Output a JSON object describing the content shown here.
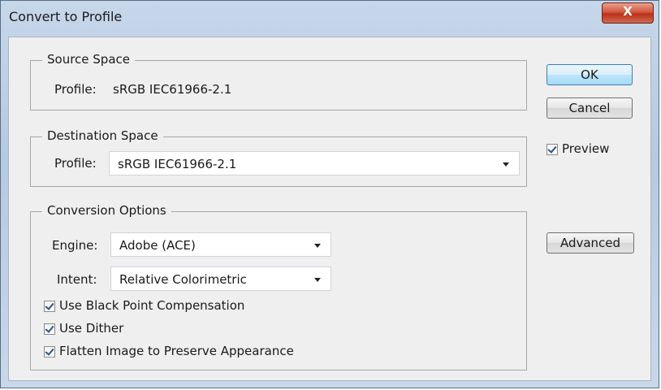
{
  "window": {
    "title": "Convert to Profile",
    "close_label": "X"
  },
  "source_space": {
    "legend": "Source Space",
    "profile_label": "Profile:",
    "profile_value": "sRGB IEC61966-2.1"
  },
  "destination_space": {
    "legend": "Destination Space",
    "profile_label": "Profile:",
    "profile_value": "sRGB IEC61966-2.1"
  },
  "conversion_options": {
    "legend": "Conversion Options",
    "engine_label": "Engine:",
    "engine_value": "Adobe (ACE)",
    "intent_label": "Intent:",
    "intent_value": "Relative Colorimetric",
    "black_point_label": "Use Black Point Compensation",
    "black_point_checked": true,
    "dither_label": "Use Dither",
    "dither_checked": true,
    "flatten_label": "Flatten Image to Preserve Appearance",
    "flatten_checked": true
  },
  "buttons": {
    "ok": "OK",
    "cancel": "Cancel",
    "advanced": "Advanced"
  },
  "preview": {
    "label": "Preview",
    "checked": true
  },
  "colors": {
    "close_button": "#d4573e",
    "default_button_border": "#3c7fb1",
    "checkmark": "#2d4f8a"
  }
}
